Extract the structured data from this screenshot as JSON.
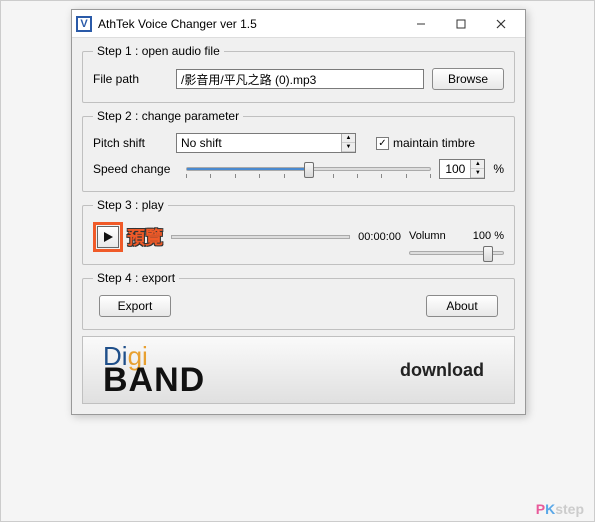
{
  "window": {
    "title": "AthTek Voice Changer ver 1.5"
  },
  "step1": {
    "legend": "Step 1 : open audio file",
    "file_path_label": "File path",
    "file_path_value": "/影音用/平凡之路 (0).mp3",
    "browse_label": "Browse"
  },
  "step2": {
    "legend": "Step 2 : change parameter",
    "pitch_label": "Pitch shift",
    "pitch_value": "No shift",
    "maintain_label": "maintain timbre",
    "maintain_checked": "✓",
    "speed_label": "Speed change",
    "speed_value": "100",
    "speed_unit": "%"
  },
  "step3": {
    "legend": "Step 3 : play",
    "preview_label": "預覽",
    "time": "00:00:00",
    "volume_label": "Volumn",
    "volume_value": "100 %"
  },
  "step4": {
    "legend": "Step 4 : export",
    "export_label": "Export",
    "about_label": "About"
  },
  "banner": {
    "download": "download"
  },
  "watermark": {
    "pk": "PK",
    "rest": "step"
  }
}
